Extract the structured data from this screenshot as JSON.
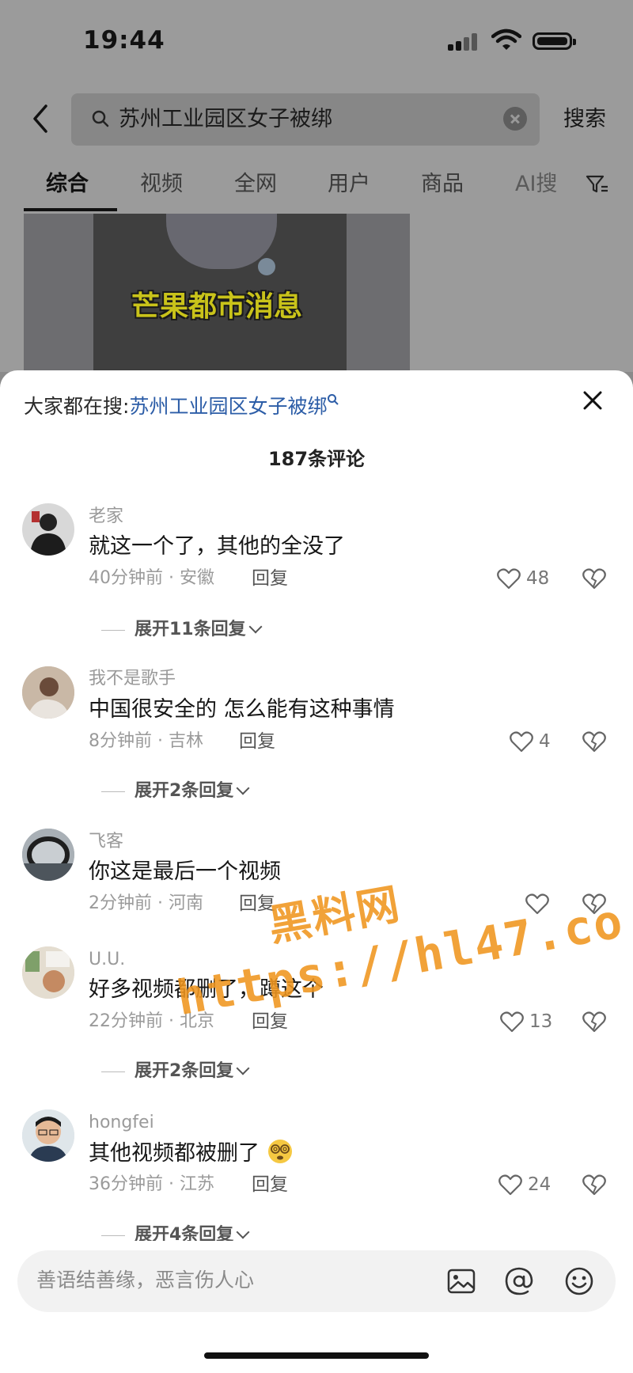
{
  "status_bar": {
    "time": "19:44"
  },
  "search": {
    "query": "苏州工业园区女子被绑",
    "button": "搜索"
  },
  "tabs": [
    "综合",
    "视频",
    "全网",
    "用户",
    "商品",
    "AI搜"
  ],
  "video": {
    "caption": "芒果都市消息"
  },
  "sheet": {
    "trending_prefix": "大家都在搜:",
    "trending_link": "苏州工业园区女子被绑",
    "comment_count": "187条评论"
  },
  "comments": [
    {
      "user": "老家",
      "text": "就这一个了，其他的全没了",
      "meta": "40分钟前 · 安徽",
      "reply": "回复",
      "likes": "48",
      "expand": "展开11条回复"
    },
    {
      "user": "我不是歌手",
      "text": "中国很安全的 怎么能有这种事情",
      "meta": "8分钟前 · 吉林",
      "reply": "回复",
      "likes": "4",
      "expand": "展开2条回复"
    },
    {
      "user": "飞客",
      "text": "你这是最后一个视频",
      "meta": "2分钟前 · 河南",
      "reply": "回复",
      "likes": "",
      "expand": ""
    },
    {
      "user": "U.U.",
      "text": "好多视频都删了，蹲这个",
      "meta": "22分钟前 · 北京",
      "reply": "回复",
      "likes": "13",
      "expand": "展开2条回复"
    },
    {
      "user": "hongfei",
      "text": "其他视频都被删了",
      "meta": "36分钟前 · 江苏",
      "reply": "回复",
      "likes": "24",
      "expand": "展开4条回复"
    }
  ],
  "watermark": {
    "line1": "黑料网",
    "line2": "https://hl47.co"
  },
  "input": {
    "placeholder": "善语结善缘，恶言伤人心"
  },
  "icons": {
    "image": "image-icon",
    "mention": "at-icon",
    "emoji": "emoji-icon"
  }
}
